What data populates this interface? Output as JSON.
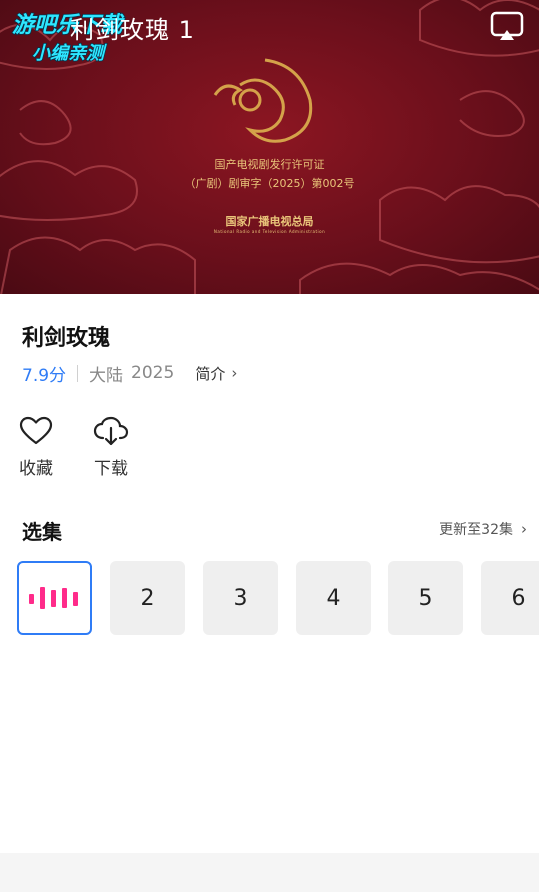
{
  "player": {
    "watermark_line1": "游吧乐下载",
    "watermark_line2": "小编亲测",
    "video_title": "利剑玫瑰 1",
    "poster": {
      "license_title": "国产电视剧发行许可证",
      "license_number": "（广剧）剧审字（2025）第002号",
      "authority_cn": "国家广播电视总局",
      "authority_en": "National Radio and Television Administration"
    },
    "cast_icon": "airplay-icon"
  },
  "show": {
    "title": "利剑玫瑰",
    "score": "7.9分",
    "region": "大陆",
    "year": "2025",
    "intro_label": "简介"
  },
  "actions": {
    "favorite_label": "收藏",
    "favorite_icon": "heart-icon",
    "download_label": "下载",
    "download_icon": "cloud-download-icon"
  },
  "episodes": {
    "section_title": "选集",
    "update_status": "更新至32集",
    "items": [
      "2",
      "3",
      "4",
      "5",
      "6"
    ],
    "playing_icon": "equalizer-icon"
  },
  "colors": {
    "accent_blue": "#2f7cf6",
    "playing_pink": "#ff2b8a"
  }
}
